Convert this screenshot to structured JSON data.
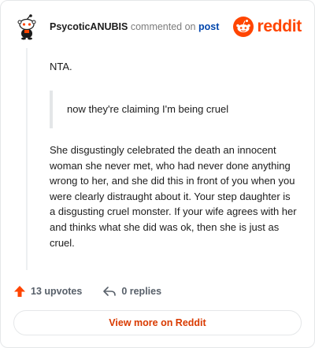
{
  "header": {
    "username": "PsycoticANUBIS",
    "action_text": "commented on",
    "post_link": "post",
    "logo_text": "reddit"
  },
  "comment": {
    "paragraph1": "NTA.",
    "quote": "now they're claiming I'm being cruel",
    "paragraph2": "She disgustingly celebrated the death an innocent woman she never met, who had never done anything wrong to her, and she did this in front of you when you were clearly distraught about it. Your step daughter is a disgusting cruel monster. If your wife agrees with her and thinks what she did was ok, then she is just as cruel."
  },
  "footer": {
    "upvotes": "13 upvotes",
    "replies": "0 replies"
  },
  "view_more_label": "View more on Reddit",
  "colors": {
    "brand": "#ff4500",
    "link": "#0045ac",
    "cta": "#d93a00"
  }
}
